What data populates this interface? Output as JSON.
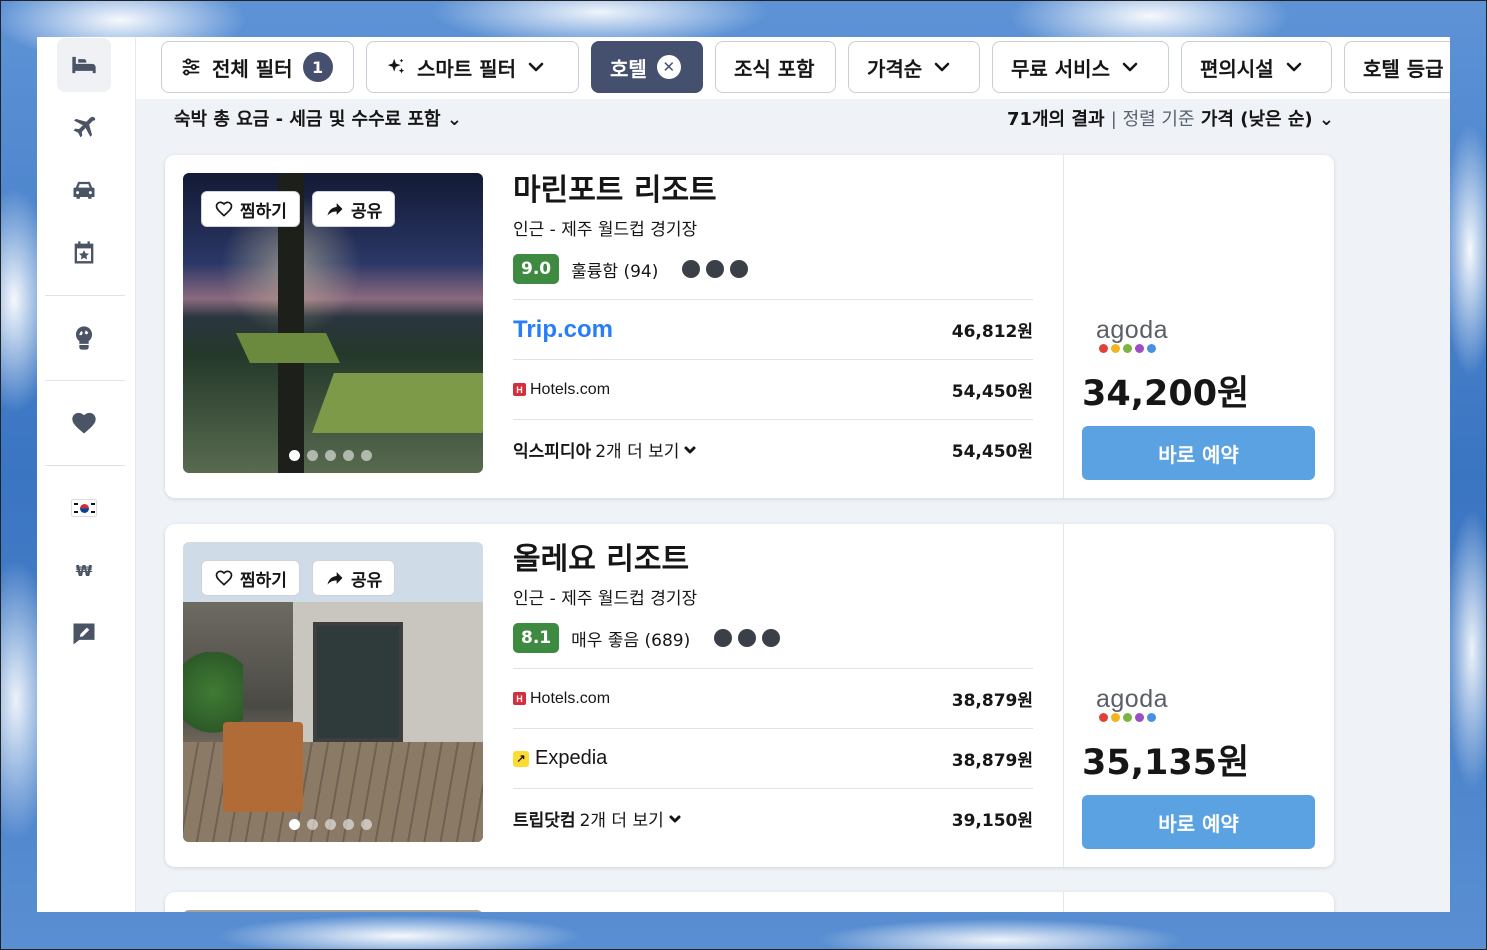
{
  "filters": {
    "all_filters": "전체 필터",
    "all_filters_count": "1",
    "smart_filter": "스마트 필터",
    "hotel": "호텔",
    "breakfast": "조식 포함",
    "price_order": "가격순",
    "free_services": "무료 서비스",
    "amenities": "편의시설",
    "hotel_grade": "호텔 등급"
  },
  "infostrip": {
    "left": "숙박 총 요금 - 세금 및 수수료 포함",
    "results": "71개의 결과",
    "sort_label": "정렬 기준",
    "sort_value": "가격 (낮은 순)"
  },
  "photo_actions": {
    "save": "찜하기",
    "share": "공유"
  },
  "hotels": [
    {
      "name": "마린포트 리조트",
      "location": "인근 - 제주 월드컵 경기장",
      "score": "9.0",
      "rating_text": "훌륭함 (94)",
      "offers": [
        {
          "provider": "Trip.com",
          "price": "46,812원"
        },
        {
          "provider": "Hotels.com",
          "price": "54,450원"
        },
        {
          "provider": "익스피디아",
          "more": "2개 더 보기",
          "price": "54,450원"
        }
      ],
      "best_provider": "agoda",
      "best_price": "34,200원",
      "book_label": "바로 예약"
    },
    {
      "name": "올레요 리조트",
      "location": "인근 - 제주 월드컵 경기장",
      "score": "8.1",
      "rating_text": "매우 좋음 (689)",
      "offers": [
        {
          "provider": "Hotels.com",
          "price": "38,879원"
        },
        {
          "provider": "Expedia",
          "price": "38,879원"
        },
        {
          "provider": "트립닷컴",
          "more": "2개 더 보기",
          "price": "39,150원"
        }
      ],
      "best_provider": "agoda",
      "best_price": "35,135원",
      "book_label": "바로 예약"
    }
  ],
  "sidebar": {
    "items": [
      "bed-icon",
      "plane-icon",
      "car-icon",
      "calendar-star-icon",
      "globe-bulb-icon",
      "heart-icon",
      "korea-flag-icon",
      "won-icon",
      "feedback-icon"
    ],
    "currency": "₩"
  },
  "colors": {
    "accent": "#454f6e",
    "score_green": "#3f8a41",
    "book_button": "#5aa2e2",
    "agoda_dots": [
      "#e0403b",
      "#f2b51e",
      "#7cb342",
      "#9c4fc2",
      "#4a90e2"
    ]
  }
}
